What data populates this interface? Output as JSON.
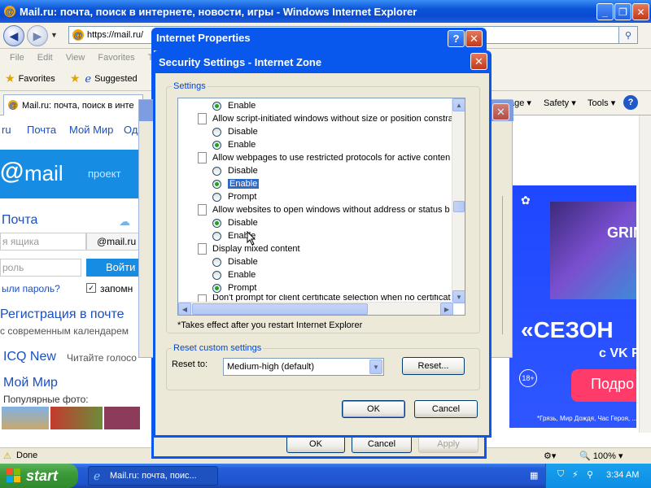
{
  "ie": {
    "title": "Mail.ru: почта, поиск в интернете, новости, игры - Windows Internet Explorer",
    "address": "https://mail.ru/",
    "menu": [
      "File",
      "Edit",
      "View",
      "Favorites",
      "To"
    ],
    "favorites_label": "Favorites",
    "suggested_label": "Suggested",
    "tab_title": "Mail.ru: почта, поиск в инте",
    "cmd_page": "age",
    "cmd_safety": "Safety",
    "cmd_tools": "Tools",
    "status_done": "Done",
    "zoom": "100%"
  },
  "web": {
    "top_links": [
      "ru",
      "Почта",
      "Мой Мир",
      "Од"
    ],
    "mail_logo": "mail",
    "project": "проект",
    "pochta_heading": "Почта",
    "login_placeholder": "я ящика",
    "domain": "@mail.ru",
    "password_placeholder": "роль",
    "login_button": "Войти",
    "forgot": "ыли пароль?",
    "remember": "запомн",
    "register": "Регистрация в почте",
    "register_sub": "с современным календарем",
    "icq": "ICQ New",
    "icq_sub": "Читайте голосо",
    "moimir": "Мой Мир",
    "moimir_sub": "Популярные фото:"
  },
  "ad": {
    "brand": "GRIN",
    "headline": "«СЕЗОН",
    "sub": "с VK F",
    "cta": "Подро",
    "age": "18+",
    "footer": "*Грязь, Мир Дождя, Час Героя, ..."
  },
  "inet_props": {
    "title": "Internet Properties",
    "ok": "OK",
    "cancel": "Cancel",
    "apply": "Apply"
  },
  "security": {
    "title": "Security Settings - Internet Zone",
    "settings_group": "Settings",
    "items": [
      {
        "type": "option",
        "label": "Enable",
        "checked": true
      },
      {
        "type": "header",
        "label": "Allow script-initiated windows without size or position constra"
      },
      {
        "type": "option",
        "label": "Disable",
        "checked": false
      },
      {
        "type": "option",
        "label": "Enable",
        "checked": true
      },
      {
        "type": "header",
        "label": "Allow webpages to use restricted protocols for active conten"
      },
      {
        "type": "option",
        "label": "Disable",
        "checked": false
      },
      {
        "type": "option",
        "label": "Enable",
        "checked": true,
        "selected": true
      },
      {
        "type": "option",
        "label": "Prompt",
        "checked": false
      },
      {
        "type": "header",
        "label": "Allow websites to open windows without address or status b"
      },
      {
        "type": "option",
        "label": "Disable",
        "checked": true
      },
      {
        "type": "option",
        "label": "Enable",
        "checked": false
      },
      {
        "type": "header",
        "label": "Display mixed content"
      },
      {
        "type": "option",
        "label": "Disable",
        "checked": false
      },
      {
        "type": "option",
        "label": "Enable",
        "checked": false
      },
      {
        "type": "option",
        "label": "Prompt",
        "checked": true
      },
      {
        "type": "header",
        "label": "Don't prompt for client certificate selection when no certificat"
      }
    ],
    "note": "*Takes effect after you restart Internet Explorer",
    "reset_group": "Reset custom settings",
    "reset_to_label": "Reset to:",
    "reset_value": "Medium-high (default)",
    "reset_button": "Reset...",
    "ok": "OK",
    "cancel": "Cancel"
  },
  "taskbar": {
    "start": "start",
    "task": "Mail.ru: почта, поис...",
    "time": "3:34 AM"
  }
}
